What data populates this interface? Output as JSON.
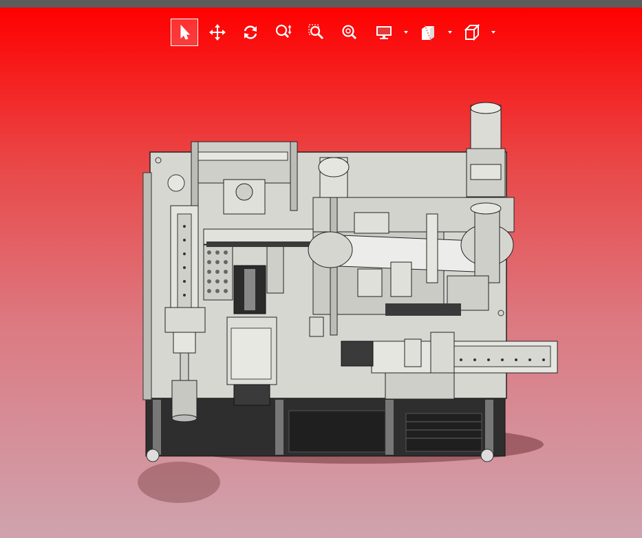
{
  "app": {
    "topbar_color": "#5c5c5c",
    "background": {
      "top": "#ff0000",
      "bottom": "#cfa3ae"
    }
  },
  "toolbar": {
    "tools": [
      {
        "id": "select",
        "icon": "select-arrow-icon",
        "active": true
      },
      {
        "id": "pan",
        "icon": "pan-move-icon",
        "active": false
      },
      {
        "id": "rotate",
        "icon": "rotate-icon",
        "active": false
      },
      {
        "id": "zoom",
        "icon": "zoom-icon",
        "active": false
      },
      {
        "id": "zoom-window",
        "icon": "zoom-window-icon",
        "active": false
      },
      {
        "id": "zoom-fit",
        "icon": "zoom-fit-icon",
        "active": false
      },
      {
        "id": "display-mode",
        "icon": "monitor-icon",
        "dropdown": true
      },
      {
        "id": "section-view",
        "icon": "section-view-icon",
        "dropdown": true
      },
      {
        "id": "view-orientation",
        "icon": "view-cube-icon",
        "dropdown": true
      }
    ]
  },
  "model": {
    "description_icon": "cad-machine-assembly-icon",
    "colors": {
      "metal": "#d9d9d4",
      "edge": "#2a2a2a",
      "frame": "#3a3a3a"
    }
  }
}
